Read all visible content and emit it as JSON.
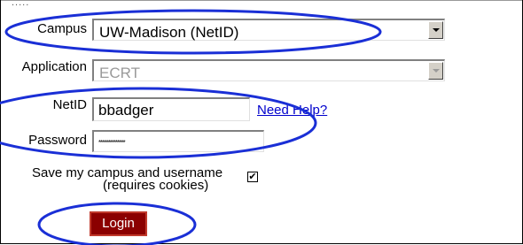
{
  "form": {
    "campus_label": "Campus",
    "campus_value": "UW-Madison (NetID)",
    "application_label": "Application",
    "application_value": "ECRT",
    "netid_label": "NetID",
    "netid_value": "bbadger",
    "help_link": "Need Help?",
    "password_label": "Password",
    "password_mask": "**************",
    "save_line1": "Save my campus and username",
    "save_line2": "(requires cookies)",
    "save_checked": "✔",
    "login_label": "Login"
  },
  "annotation_color": "#1a2fd6",
  "button_color": "#8b0000"
}
